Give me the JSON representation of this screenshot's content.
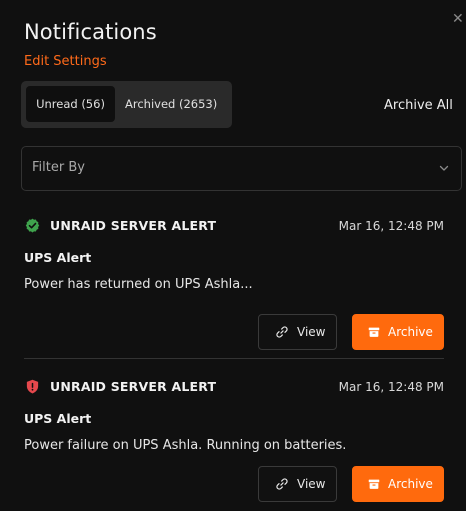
{
  "panel": {
    "title": "Notifications",
    "edit_settings_label": "Edit Settings",
    "close_icon": "close-icon"
  },
  "tabs": [
    {
      "label": "Unread (56)",
      "active": true
    },
    {
      "label": "Archived (2653)",
      "active": false
    }
  ],
  "archive_all_label": "Archive All",
  "filter": {
    "label": "Filter By",
    "icon": "chevron-down-icon"
  },
  "notifications": [
    {
      "status": "success",
      "status_icon": "check-circle-icon",
      "status_color": "#3fa34d",
      "title": "UNRAID SERVER ALERT",
      "timestamp": "Mar 16, 12:48 PM",
      "subject": "UPS Alert",
      "message": "Power has returned on UPS Ashla...",
      "view_label": "View",
      "archive_label": "Archive"
    },
    {
      "status": "alert",
      "status_icon": "alert-shield-icon",
      "status_color": "#e5484d",
      "title": "UNRAID SERVER ALERT",
      "timestamp": "Mar 16, 12:48 PM",
      "subject": "UPS Alert",
      "message": "Power failure on UPS Ashla. Running on batteries.",
      "view_label": "View",
      "archive_label": "Archive"
    }
  ],
  "colors": {
    "accent": "#ff6a0d",
    "background": "#101010",
    "tab_bar": "#2a2a2a"
  }
}
